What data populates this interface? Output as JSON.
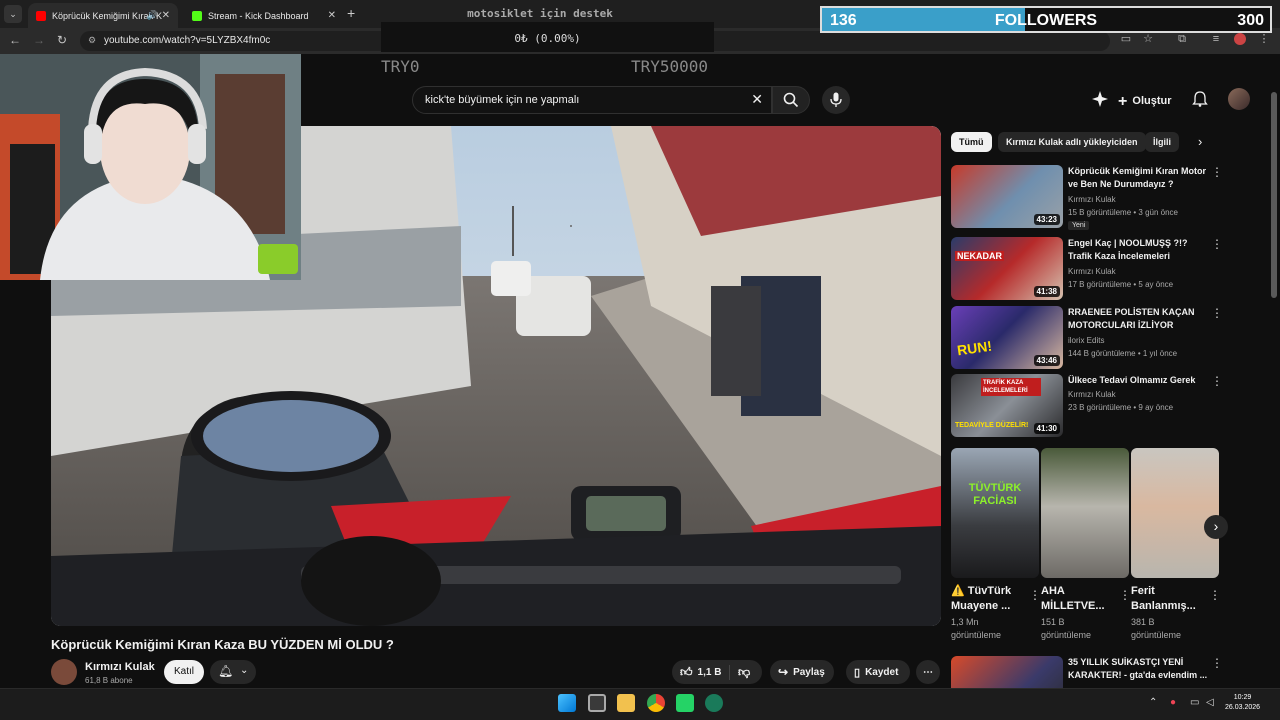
{
  "browser": {
    "tabs": [
      {
        "title": "Köprücük Kemiğimi Kıran K",
        "active": true
      },
      {
        "title": "Stream - Kick Dashboard",
        "active": false
      }
    ],
    "url": "youtube.com/watch?v=5LYZBX4fm0c"
  },
  "overlays": {
    "donation_title": "motosiklet için destek",
    "donation_status": "0₺ (0.00%)",
    "donation_min": "TRY0",
    "donation_max": "TRY50000",
    "followers": {
      "current": "136",
      "label": "FOLLOWERS",
      "goal": "300",
      "progress": 0.4533
    }
  },
  "youtube": {
    "search_query": "kick'te büyümek için ne yapmalı",
    "create_label": "Oluştur",
    "video": {
      "title": "Köprücük Kemiğimi Kıran Kaza BU YÜZDEN Mİ OLDU ?",
      "channel": "Kırmızı Kulak",
      "subscribers": "61,8 B abone",
      "join_label": "Katıl",
      "likes": "1,1 B",
      "share_label": "Paylaş",
      "save_label": "Kaydet"
    },
    "chips": [
      "Tümü",
      "Kırmızı Kulak adlı yükleyiciden",
      "İlgili"
    ],
    "recommendations": [
      {
        "title": "Köprücük Kemiğimi Kıran Motor ve Ben Ne Durumdayız ?",
        "channel": "Kırmızı Kulak",
        "meta": "15 B görüntüleme • 3 gün önce",
        "badge": "Yeni",
        "duration": "43:23"
      },
      {
        "title": "Engel Kaç | NOOLMUŞŞ ?!? Trafik Kaza İncelemeleri",
        "channel": "Kırmızı Kulak",
        "meta": "17 B görüntüleme • 5 ay önce",
        "duration": "41:38"
      },
      {
        "title": "RRAENEE POLİSTEN KAÇAN MOTORCULARI İZLİYOR",
        "channel": "ilorix Edits",
        "meta": "144 B görüntüleme • 1 yıl önce",
        "duration": "43:46"
      },
      {
        "title": "Ülkece Tedavi Olmamız Gerek",
        "channel": "Kırmızı Kulak",
        "meta": "23 B görüntüleme • 9 ay önce",
        "duration": "41:30"
      }
    ],
    "shorts": [
      {
        "title": "⚠️ TüvTürk\nMuayene ...",
        "views": "1,3 Mn\ngörüntüleme"
      },
      {
        "title": "AHA\nMİLLETVE...",
        "views": "151 B\ngörüntüleme"
      },
      {
        "title": "Ferit\nBanlanmış...",
        "views": "381 B\ngörüntüleme"
      }
    ],
    "next_rec": {
      "title": "35 YILLIK SUİKASTÇI YENİ KARAKTER! - gta'da evlendim ..."
    }
  },
  "thumb_text": {
    "rec1": "",
    "rec2": "NEKADAR",
    "rec3": "RUN!",
    "rec4a": "TRAFİK KAZA İNCELEMELERİ",
    "rec4b": "TEDAVİYLE DÜZELİR!",
    "short1": "TÜVTÜRK FACİASI"
  },
  "taskbar": {
    "time": "10:29",
    "date": "26.03.2026"
  }
}
